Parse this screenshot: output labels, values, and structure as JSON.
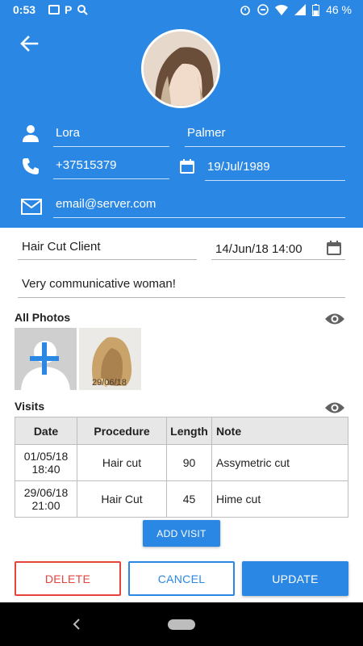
{
  "status_bar": {
    "time": "0:53",
    "battery": "46 %"
  },
  "profile": {
    "first_name": "Lora",
    "last_name": "Palmer",
    "phone": "+37515379",
    "birth_date": "19/Jul/1989",
    "email": "email@server.com"
  },
  "details": {
    "client_type": "Hair Cut Client",
    "datetime": "14/Jun/18 14:00",
    "note": "Very communicative woman!"
  },
  "photos": {
    "title": "All Photos",
    "items": [
      {
        "date": "29/06/18"
      }
    ]
  },
  "visits": {
    "title": "Visits",
    "columns": [
      "Date",
      "Procedure",
      "Length",
      "Note"
    ],
    "rows": [
      {
        "date_line1": "01/05/18",
        "date_line2": "18:40",
        "procedure": "Hair cut",
        "length": "90",
        "note": "Assymetric cut"
      },
      {
        "date_line1": "29/06/18",
        "date_line2": "21:00",
        "procedure": "Hair Cut",
        "length": "45",
        "note": "Hime cut"
      }
    ],
    "add_button": "ADD VISIT"
  },
  "actions": {
    "delete": "DELETE",
    "cancel": "CANCEL",
    "update": "UPDATE"
  },
  "colors": {
    "primary": "#2a87e3",
    "danger": "#e8433b"
  },
  "icons": [
    "back-arrow-icon",
    "person-icon",
    "phone-icon",
    "calendar-icon",
    "mail-icon",
    "eye-icon",
    "add-photo-icon"
  ]
}
